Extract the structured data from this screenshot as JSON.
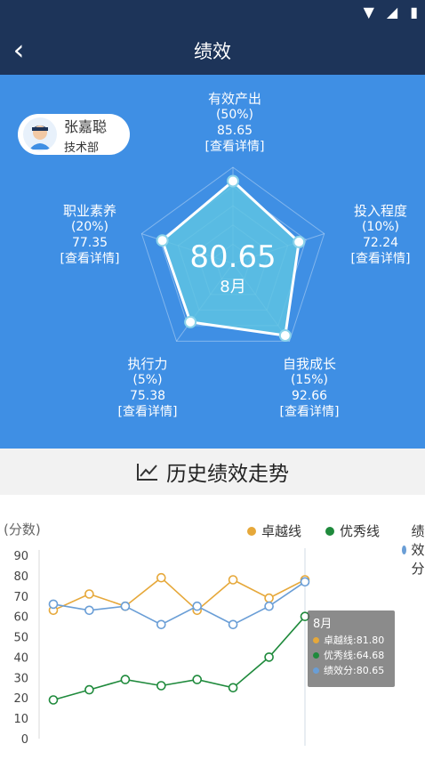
{
  "status_bar": {
    "icons": [
      "wifi-icon",
      "signal-icon",
      "battery-icon"
    ]
  },
  "app_bar": {
    "title": "绩效",
    "back_icon": "chevron-left-icon"
  },
  "user": {
    "name": "张嘉聪",
    "department": "技术部"
  },
  "overall": {
    "score": "80.65",
    "month": "8月"
  },
  "metrics": {
    "output": {
      "label": "有效产出",
      "weight": "(50%)",
      "value": "85.65",
      "link": "[查看详情]"
    },
    "engagement": {
      "label": "投入程度",
      "weight": "(10%)",
      "value": "72.24",
      "link": "[查看详情]"
    },
    "growth": {
      "label": "自我成长",
      "weight": "(15%)",
      "value": "92.66",
      "link": "[查看详情]"
    },
    "execution": {
      "label": "执行力",
      "weight": "(5%)",
      "value": "75.38",
      "link": "[查看详情]"
    },
    "quality": {
      "label": "职业素养",
      "weight": "(20%)",
      "value": "77.35",
      "link": "[查看详情]"
    }
  },
  "trend": {
    "title": "历史绩效走势",
    "icon": "line-chart-icon"
  },
  "chart_data": {
    "type": "line",
    "ylabel": "(分数)",
    "ylim": [
      0,
      90
    ],
    "yticks": [
      0,
      10,
      20,
      30,
      40,
      50,
      60,
      70,
      80,
      90
    ],
    "grid": false,
    "legend_position": "top-right",
    "series": [
      {
        "name": "卓越线",
        "color": "#e6a83a",
        "values": [
          63,
          71,
          65,
          79,
          63,
          78,
          69,
          78
        ]
      },
      {
        "name": "优秀线",
        "color": "#1f8a3c",
        "values": [
          19,
          24,
          29,
          26,
          29,
          25,
          40,
          60
        ]
      },
      {
        "name": "绩效分",
        "color": "#6a9ed6",
        "values": [
          66,
          63,
          65,
          56,
          65,
          56,
          65,
          77
        ]
      }
    ],
    "tooltip": {
      "month": "8月",
      "rows": [
        {
          "text": "卓越线:81.80",
          "color": "#e6a83a"
        },
        {
          "text": "优秀线:64.68",
          "color": "#1f8a3c"
        },
        {
          "text": "绩效分:80.65",
          "color": "#6a9ed6"
        }
      ]
    }
  }
}
